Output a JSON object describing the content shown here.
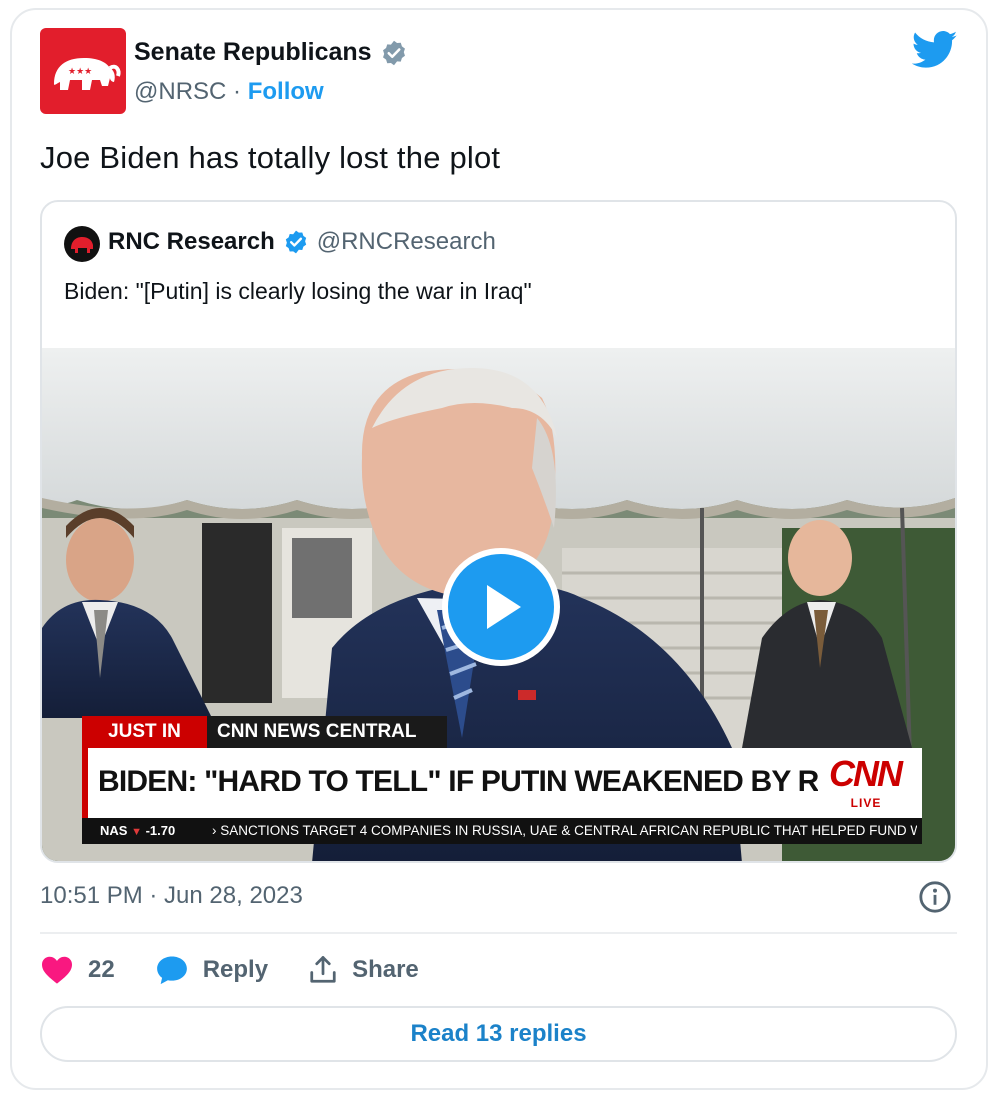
{
  "author": {
    "name": "Senate Republicans",
    "handle": "@NRSC",
    "separator": "·",
    "follow_label": "Follow"
  },
  "tweet": {
    "text": "Joe Biden has totally lost the plot",
    "timestamp": "10:51 PM · Jun 28, 2023"
  },
  "quoted_tweet": {
    "name": "RNC Research",
    "handle": "@RNCResearch",
    "text": "Biden: \"[Putin] is clearly losing the war in Iraq\""
  },
  "video": {
    "just_in": "JUST IN",
    "program": "CNN NEWS CENTRAL",
    "headline": "BIDEN: \"HARD TO TELL\" IF PUTIN WEAKENED BY REVOLT",
    "network": "CNN",
    "live": "LIVE",
    "ticker_symbol": "NAS",
    "ticker_value": "-1.70",
    "ticker_text": "› SANCTIONS TARGET 4 COMPANIES IN RUSSIA, UAE & CENTRAL AFRICAN REPUBLIC THAT HELPED FUND WAGNER"
  },
  "actions": {
    "likes": "22",
    "reply_label": "Reply",
    "share_label": "Share"
  },
  "read_replies_label": "Read 13 replies",
  "colors": {
    "accent": "#1d9bf0",
    "like": "#f91880",
    "cnn_red": "#cc0000",
    "brand_red": "#e21e2c"
  },
  "icons": [
    "elephant-logo-icon",
    "verified-badge-icon",
    "twitter-bird-icon",
    "play-icon",
    "info-icon",
    "heart-icon",
    "reply-bubble-icon",
    "share-icon"
  ]
}
